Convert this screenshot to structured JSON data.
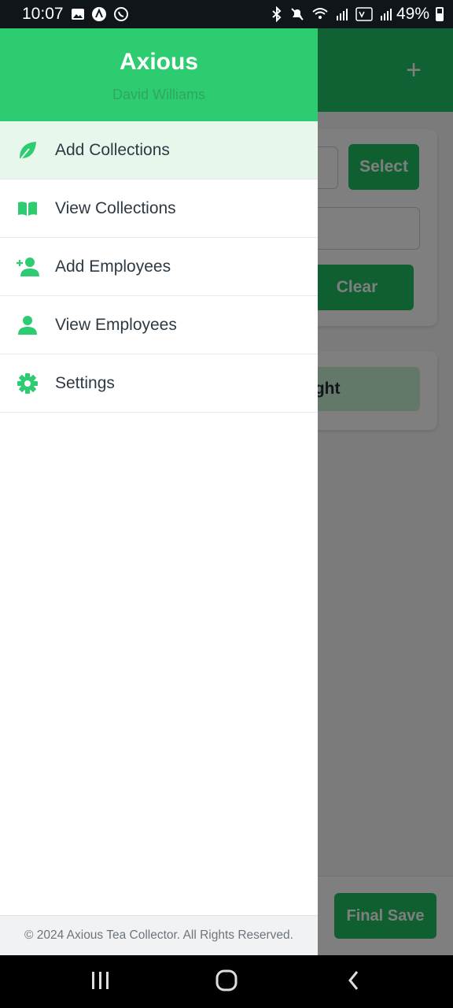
{
  "status_bar": {
    "time": "10:07",
    "battery": "49%",
    "icons": [
      "gallery-icon",
      "a-icon",
      "whatsapp-icon",
      "bluetooth-icon",
      "mute-icon",
      "wifi-icon",
      "signal-icon",
      "volte-icon",
      "battery-icon"
    ]
  },
  "background": {
    "select_button": "Select",
    "clear_button": "Clear",
    "weight_text": "ight",
    "final_save_button": "Final Save"
  },
  "drawer": {
    "title": "Axious",
    "subtitle": "David Williams",
    "items": [
      {
        "label": "Add Collections",
        "icon": "leaf-icon",
        "active": true
      },
      {
        "label": "View Collections",
        "icon": "book-icon",
        "active": false
      },
      {
        "label": "Add Employees",
        "icon": "add-person-icon",
        "active": false
      },
      {
        "label": "View Employees",
        "icon": "person-icon",
        "active": false
      },
      {
        "label": "Settings",
        "icon": "gear-icon",
        "active": false
      }
    ],
    "footer": "© 2024 Axious Tea Collector. All Rights Reserved."
  },
  "nav_bar": {
    "buttons": [
      "recent-apps",
      "home",
      "back"
    ]
  },
  "colors": {
    "accent": "#2ecc71",
    "overlay": "rgba(0,0,0,0.5)",
    "text": "#2d3a44"
  }
}
